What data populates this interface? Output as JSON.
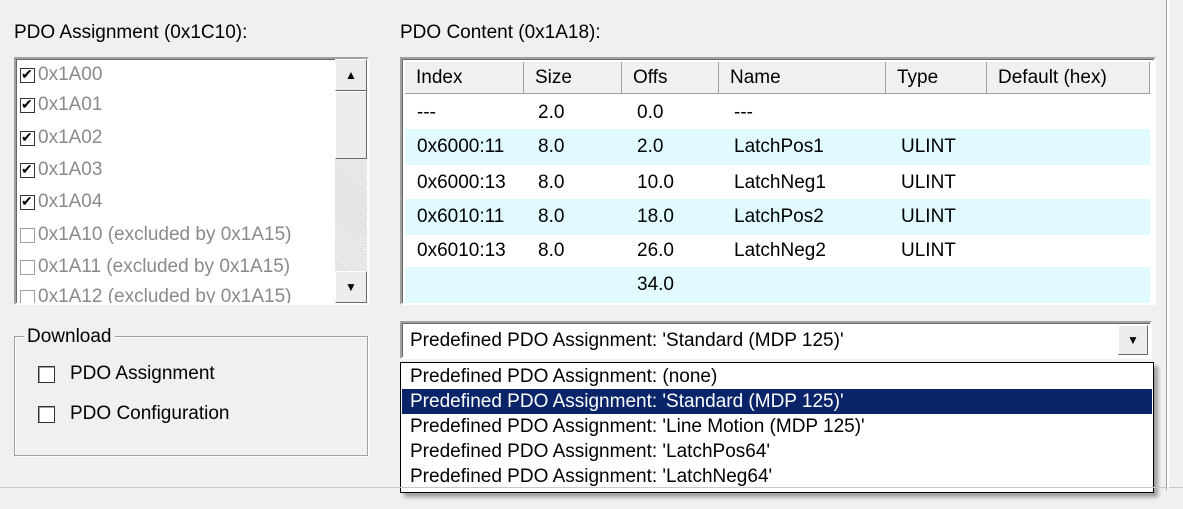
{
  "assignment": {
    "caption": "PDO Assignment (0x1C10):",
    "items": [
      {
        "label": "0x1A00",
        "checked": true
      },
      {
        "label": "0x1A01",
        "checked": true
      },
      {
        "label": "0x1A02",
        "checked": true
      },
      {
        "label": "0x1A03",
        "checked": true
      },
      {
        "label": "0x1A04",
        "checked": true
      },
      {
        "label": "0x1A10 (excluded by 0x1A15)",
        "checked": false
      },
      {
        "label": "0x1A11 (excluded by 0x1A15)",
        "checked": false
      },
      {
        "label": "0x1A12 (excluded by 0x1A15)",
        "checked": false
      }
    ]
  },
  "content": {
    "caption": "PDO Content (0x1A18):",
    "columns": [
      "Index",
      "Size",
      "Offs",
      "Name",
      "Type",
      "Default (hex)"
    ],
    "rows": [
      [
        "---",
        "2.0",
        "0.0",
        "---",
        "",
        ""
      ],
      [
        "0x6000:11",
        "8.0",
        "2.0",
        "LatchPos1",
        "ULINT",
        ""
      ],
      [
        "0x6000:13",
        "8.0",
        "10.0",
        "LatchNeg1",
        "ULINT",
        ""
      ],
      [
        "0x6010:11",
        "8.0",
        "18.0",
        "LatchPos2",
        "ULINT",
        ""
      ],
      [
        "0x6010:13",
        "8.0",
        "26.0",
        "LatchNeg2",
        "ULINT",
        ""
      ],
      [
        "",
        "",
        "34.0",
        "",
        "",
        ""
      ]
    ]
  },
  "download": {
    "legend": "Download",
    "options": [
      {
        "label": "PDO Assignment",
        "checked": false
      },
      {
        "label": "PDO Configuration",
        "checked": false
      }
    ]
  },
  "predefined": {
    "selected": "Predefined PDO Assignment: 'Standard (MDP 125)'",
    "options": [
      "Predefined PDO Assignment: (none)",
      "Predefined PDO Assignment: 'Standard (MDP 125)'",
      "Predefined PDO Assignment: 'Line Motion (MDP 125)'",
      "Predefined PDO Assignment: 'LatchPos64'",
      "Predefined PDO Assignment: 'LatchNeg64'"
    ],
    "highlighted_index": 1
  },
  "colors": {
    "alt_row": "#e0fafe",
    "selection": "#0a246a",
    "disabled_text": "#8a8a8a"
  }
}
